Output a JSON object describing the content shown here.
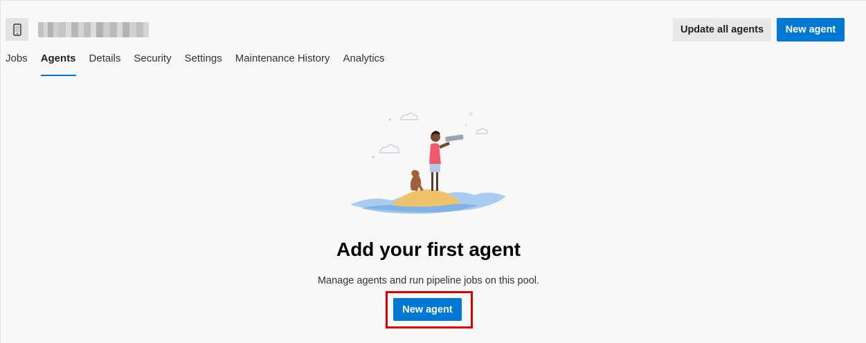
{
  "header": {
    "pool_icon": "device-icon",
    "pool_name": "████████████████",
    "update_all_label": "Update all agents",
    "new_agent_label": "New agent"
  },
  "tabs": [
    {
      "label": "Jobs",
      "active": false
    },
    {
      "label": "Agents",
      "active": true
    },
    {
      "label": "Details",
      "active": false
    },
    {
      "label": "Security",
      "active": false
    },
    {
      "label": "Settings",
      "active": false
    },
    {
      "label": "Maintenance History",
      "active": false
    },
    {
      "label": "Analytics",
      "active": false
    }
  ],
  "empty_state": {
    "illustration": "person-with-telescope-and-dog-on-island",
    "title": "Add your first agent",
    "description": "Manage agents and run pipeline jobs on this pool.",
    "button_label": "New agent"
  },
  "colors": {
    "accent": "#0078d4",
    "highlight": "#e00000",
    "background": "#f8f8f8"
  }
}
